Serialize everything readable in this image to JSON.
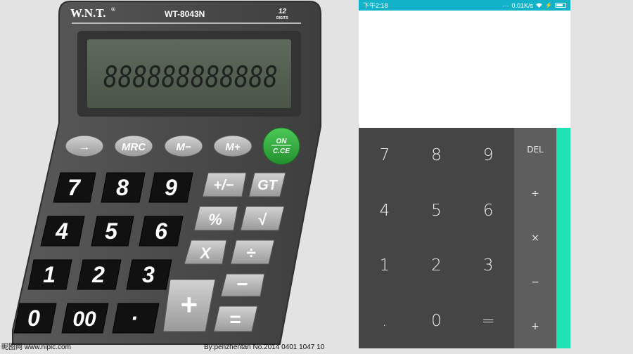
{
  "illustration": {
    "brand": "W.N.T.",
    "registered_mark": "®",
    "model": "WT-8043N",
    "digits_count": "12",
    "digits_word": "DIGITS",
    "lcd_text": "888888888888",
    "top_keys": [
      "→",
      "MRC",
      "M−",
      "M+"
    ],
    "on_key_line1": "ON",
    "on_key_line2": "C.CE",
    "number_keys": [
      "7",
      "8",
      "9",
      "4",
      "5",
      "6",
      "1",
      "2",
      "3",
      "0",
      "00",
      "·"
    ],
    "function_keys": [
      "+/−",
      "GT",
      "%",
      "√",
      "X",
      "÷",
      "+",
      "−",
      "="
    ],
    "watermark_left": "昵图网 www.nipic.com",
    "watermark_right": "By:penzhentan  No.2014 0401 1047 10"
  },
  "status_bar": {
    "time": "下午2:18",
    "speed": "0.01K/s",
    "battery_level": 0.75
  },
  "keypad": {
    "digits": [
      "7",
      "8",
      "9",
      "4",
      "5",
      "6",
      "1",
      "2",
      "3",
      ".",
      "0",
      "="
    ],
    "operators": [
      "DEL",
      "÷",
      "×",
      "−",
      "+"
    ]
  },
  "colors": {
    "status_bar": "#12b3c9",
    "digit_pad": "#454545",
    "operator_column": "#5e5e5e",
    "accent": "#1de2b4",
    "on_key": "#2ea83a"
  }
}
